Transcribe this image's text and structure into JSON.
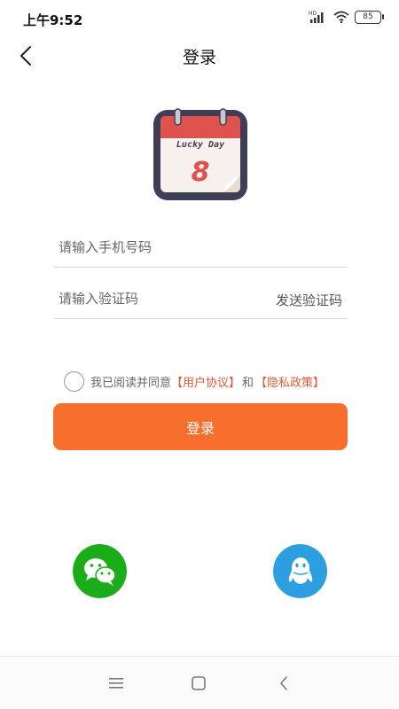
{
  "status_bar": {
    "time": "上午9:52",
    "network_label": "HD",
    "battery_level": "85",
    "icons": [
      "signal-icon",
      "wifi-icon",
      "battery-icon"
    ]
  },
  "nav": {
    "title": "登录",
    "back_icon": "chevron-left-icon"
  },
  "logo": {
    "text": "Lucky Day",
    "digit": "8",
    "colors": {
      "frame": "#3e3f56",
      "header": "#e0524c",
      "page": "#f6f1ec",
      "digit": "#e0524c"
    }
  },
  "form": {
    "phone_placeholder": "请输入手机号码",
    "phone_value": "",
    "code_placeholder": "请输入验证码",
    "code_value": "",
    "send_code_label": "发送验证码"
  },
  "agreement": {
    "checked": false,
    "prefix": "我已阅读并同意",
    "user_agreement": "【用户协议】",
    "conjunction": "和",
    "privacy_policy": "【隐私政策】",
    "link_color": "#e05a35"
  },
  "login_button": {
    "label": "登录",
    "color": "#f76f2c"
  },
  "social": {
    "wechat_icon": "wechat-icon",
    "wechat_color": "#1aad19",
    "qq_icon": "qq-icon",
    "qq_color": "#2d9ee0"
  },
  "system_nav": {
    "icons": [
      "menu-icon",
      "home-icon",
      "back-icon"
    ]
  }
}
